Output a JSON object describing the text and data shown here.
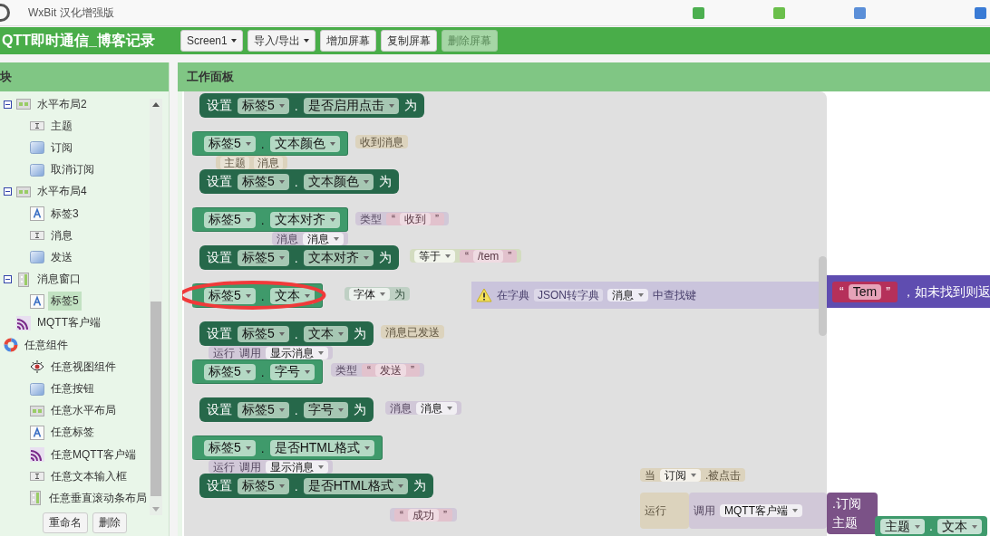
{
  "app": {
    "title": "WxBit 汉化增强版"
  },
  "project": {
    "name": "QTT即时通信_博客记录"
  },
  "toolbar": [
    {
      "label": "Screen1",
      "dropdown": true,
      "disabled": false
    },
    {
      "label": "导入/导出",
      "dropdown": true,
      "disabled": false
    },
    {
      "label": "增加屏幕",
      "dropdown": false,
      "disabled": false
    },
    {
      "label": "复制屏幕",
      "dropdown": false,
      "disabled": false
    },
    {
      "label": "删除屏幕",
      "dropdown": false,
      "disabled": true
    }
  ],
  "sidebar": {
    "title": "块",
    "tree": [
      {
        "label": "水平布局2",
        "kind": "hlayout",
        "expanded": true,
        "selected": false,
        "children": [
          {
            "label": "主题",
            "kind": "textbox",
            "selected": false
          },
          {
            "label": "订阅",
            "kind": "button",
            "selected": false
          },
          {
            "label": "取消订阅",
            "kind": "button",
            "selected": false
          }
        ]
      },
      {
        "label": "水平布局4",
        "kind": "hlayout",
        "expanded": true,
        "selected": false,
        "children": [
          {
            "label": "标签3",
            "kind": "label",
            "selected": false
          },
          {
            "label": "消息",
            "kind": "textbox",
            "selected": false
          },
          {
            "label": "发送",
            "kind": "button",
            "selected": false
          }
        ]
      },
      {
        "label": "消息窗口",
        "kind": "vscroll",
        "expanded": true,
        "selected": false,
        "children": [
          {
            "label": "标签5",
            "kind": "label",
            "selected": true
          }
        ]
      },
      {
        "label": "MQTT客户端",
        "kind": "mqtt",
        "selected": false
      },
      {
        "label": "任意组件",
        "kind": "any",
        "selected": false,
        "children": [
          {
            "label": "任意视图组件",
            "kind": "eye",
            "selected": false
          },
          {
            "label": "任意按钮",
            "kind": "button",
            "selected": false
          },
          {
            "label": "任意水平布局",
            "kind": "hlayout",
            "selected": false
          },
          {
            "label": "任意标签",
            "kind": "label",
            "selected": false
          },
          {
            "label": "任意MQTT客户端",
            "kind": "mqtt",
            "selected": false
          },
          {
            "label": "任意文本输入框",
            "kind": "textbox",
            "selected": false
          },
          {
            "label": "任意垂直滚动条布局",
            "kind": "vscroll",
            "selected": false
          }
        ]
      }
    ],
    "buttons": [
      "重命名",
      "删除"
    ]
  },
  "workspace": {
    "title": "工作面板",
    "background_blocks": [
      {
        "kind": "event",
        "faded": true,
        "rows": [
          [
            {
              "kind": "word",
              "text": "收到消息"
            }
          ]
        ]
      },
      {
        "kind": "event",
        "faded": true,
        "rows": [
          [
            {
              "kind": "field",
              "text": "主题"
            },
            {
              "kind": "field",
              "text": "消息"
            }
          ]
        ]
      },
      {
        "kind": "call",
        "faded": true,
        "rows": [
          [
            {
              "kind": "word",
              "text": "类型"
            },
            {
              "kind": "string",
              "open": "“",
              "text": "收到",
              "close": "”"
            }
          ]
        ]
      },
      {
        "kind": "call",
        "faded": true,
        "rows": [
          [
            {
              "kind": "word",
              "text": "消息"
            },
            {
              "kind": "dropdown",
              "text": "消息"
            }
          ]
        ]
      },
      {
        "kind": "compare",
        "faded": true,
        "rows": [
          [
            {
              "kind": "dropdown",
              "text": "等于"
            },
            {
              "kind": "string",
              "open": "“",
              "text": "/tem",
              "close": "”"
            }
          ]
        ]
      },
      {
        "kind": "setter",
        "faded": true,
        "rows": [
          [
            {
              "kind": "dropdown",
              "text": "字体"
            },
            {
              "kind": "word",
              "text": "为"
            }
          ]
        ]
      },
      {
        "kind": "dict",
        "faded": true,
        "rows": [
          [
            {
              "kind": "warning"
            },
            {
              "kind": "word",
              "text": "在字典"
            },
            {
              "kind": "field",
              "text": "JSON转字典"
            },
            {
              "kind": "dropdown",
              "text": "消息"
            },
            {
              "kind": "word",
              "text": "中查找键"
            }
          ]
        ]
      },
      {
        "kind": "dict",
        "faded": false,
        "rows": [
          [
            {
              "kind": "string",
              "open": "“",
              "text": "Tem",
              "close": "”"
            },
            {
              "kind": "word",
              "text": "，如未找到则返"
            }
          ]
        ]
      },
      {
        "kind": "event",
        "faded": true,
        "rows": [
          [
            {
              "kind": "word",
              "text": "消息已发送"
            }
          ]
        ]
      },
      {
        "kind": "call",
        "faded": true,
        "rows": [
          [
            {
              "kind": "word",
              "text": "运行"
            },
            {
              "kind": "word",
              "text": "调用"
            },
            {
              "kind": "dropdown",
              "text": "显示消息"
            }
          ]
        ]
      },
      {
        "kind": "call",
        "faded": true,
        "rows": [
          [
            {
              "kind": "word",
              "text": "类型"
            },
            {
              "kind": "string",
              "open": "“",
              "text": "发送",
              "close": "”"
            }
          ]
        ]
      },
      {
        "kind": "call",
        "faded": true,
        "rows": [
          [
            {
              "kind": "word",
              "text": "消息"
            },
            {
              "kind": "dropdown",
              "text": "消息"
            }
          ]
        ]
      },
      {
        "kind": "call",
        "faded": true,
        "rows": [
          [
            {
              "kind": "word",
              "text": "运行"
            },
            {
              "kind": "word",
              "text": "调用"
            },
            {
              "kind": "dropdown",
              "text": "显示消息"
            }
          ]
        ]
      },
      {
        "kind": "call",
        "faded": true,
        "rows": [
          [
            {
              "kind": "string",
              "open": "“",
              "text": "成功",
              "close": "”"
            }
          ]
        ]
      },
      {
        "kind": "event",
        "faded": true,
        "rows": [
          [
            {
              "kind": "word",
              "text": "当"
            },
            {
              "kind": "dropdown",
              "text": "订阅"
            },
            {
              "kind": "word",
              "text": ".被点击"
            }
          ]
        ]
      },
      {
        "kind": "event",
        "faded": true,
        "rows": [
          [
            {
              "kind": "word",
              "text": "运行"
            }
          ]
        ]
      },
      {
        "kind": "call",
        "faded": true,
        "rows": [
          [
            {
              "kind": "word",
              "text": "调用"
            },
            {
              "kind": "dropdown",
              "text": "MQTT客户端"
            }
          ]
        ]
      },
      {
        "kind": "call",
        "faded": false,
        "rows": [
          [
            {
              "kind": "word",
              "text": ".订阅"
            }
          ],
          [
            {
              "kind": "word",
              "text": "主题"
            }
          ]
        ]
      },
      {
        "kind": "getter",
        "faded": false,
        "rows": [
          [
            {
              "kind": "dropdown",
              "text": "主题"
            },
            {
              "kind": "word",
              "text": "."
            },
            {
              "kind": "dropdown",
              "text": "文本"
            }
          ]
        ]
      }
    ],
    "flyout": {
      "blocks": [
        {
          "kind": "setter",
          "prefix": "设置",
          "component": "标签5",
          "separator": ".",
          "property": "是否启用点击",
          "suffix": "为",
          "circled": false
        },
        {
          "kind": "getter",
          "component": "标签5",
          "separator": ".",
          "property": "文本颜色",
          "circled": false
        },
        {
          "kind": "setter",
          "prefix": "设置",
          "component": "标签5",
          "separator": ".",
          "property": "文本颜色",
          "suffix": "为",
          "circled": false
        },
        {
          "kind": "getter",
          "component": "标签5",
          "separator": ".",
          "property": "文本对齐",
          "circled": false
        },
        {
          "kind": "setter",
          "prefix": "设置",
          "component": "标签5",
          "separator": ".",
          "property": "文本对齐",
          "suffix": "为",
          "circled": false
        },
        {
          "kind": "getter",
          "component": "标签5",
          "separator": ".",
          "property": "文本",
          "circled": true
        },
        {
          "kind": "setter",
          "prefix": "设置",
          "component": "标签5",
          "separator": ".",
          "property": "文本",
          "suffix": "为",
          "circled": false
        },
        {
          "kind": "getter",
          "component": "标签5",
          "separator": ".",
          "property": "字号",
          "circled": false
        },
        {
          "kind": "setter",
          "prefix": "设置",
          "component": "标签5",
          "separator": ".",
          "property": "字号",
          "suffix": "为",
          "circled": false
        },
        {
          "kind": "getter",
          "component": "标签5",
          "separator": ".",
          "property": "是否HTML格式",
          "circled": false
        },
        {
          "kind": "setter",
          "prefix": "设置",
          "component": "标签5",
          "separator": ".",
          "property": "是否HTML格式",
          "suffix": "为",
          "circled": false
        }
      ]
    }
  }
}
